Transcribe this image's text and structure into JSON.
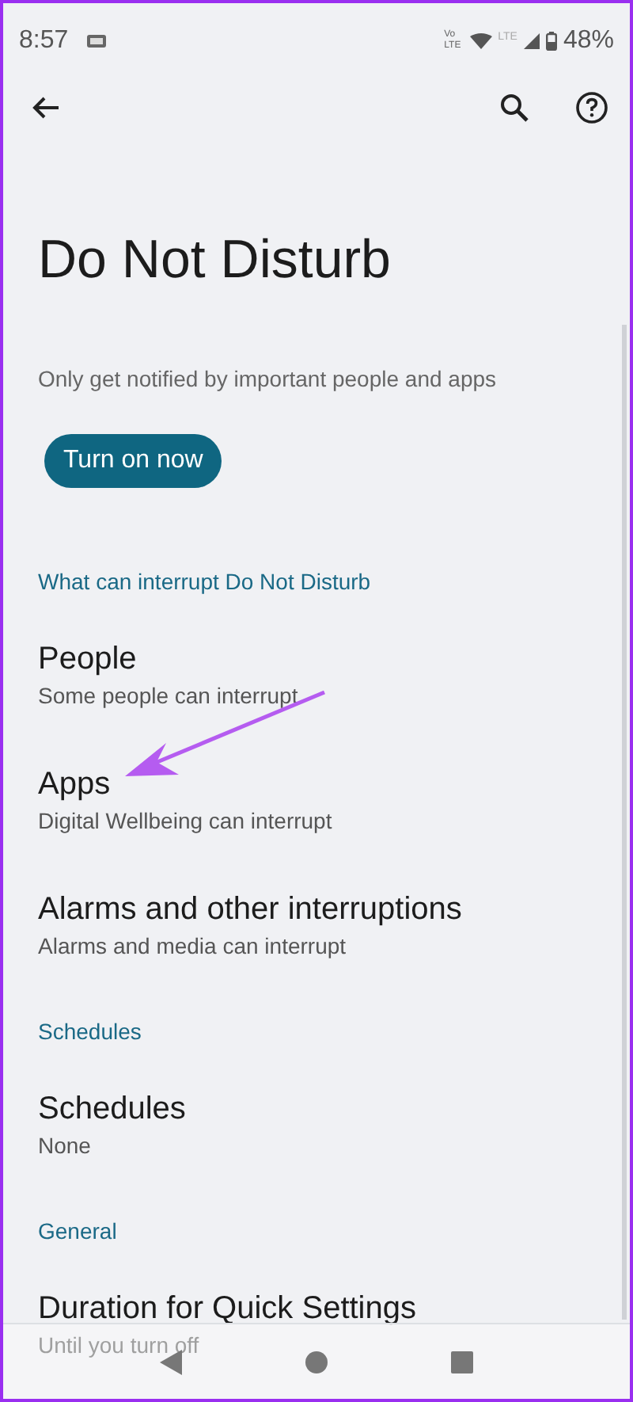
{
  "status_bar": {
    "time": "8:57",
    "volte": "Vo LTE",
    "network": "LTE",
    "battery": "48%"
  },
  "title": "Do Not Disturb",
  "description": "Only get notified by important people and apps",
  "turn_on_button": "Turn on now",
  "sections": [
    {
      "header": "What can interrupt Do Not Disturb",
      "items": [
        {
          "title": "People",
          "summary": "Some people can interrupt"
        },
        {
          "title": "Apps",
          "summary": "Digital Wellbeing can interrupt"
        },
        {
          "title": "Alarms and other interruptions",
          "summary": "Alarms and media can interrupt"
        }
      ]
    },
    {
      "header": "Schedules",
      "items": [
        {
          "title": "Schedules",
          "summary": "None"
        }
      ]
    },
    {
      "header": "General",
      "items": [
        {
          "title": "Duration for Quick Settings",
          "summary": "Until you turn off"
        }
      ]
    }
  ]
}
